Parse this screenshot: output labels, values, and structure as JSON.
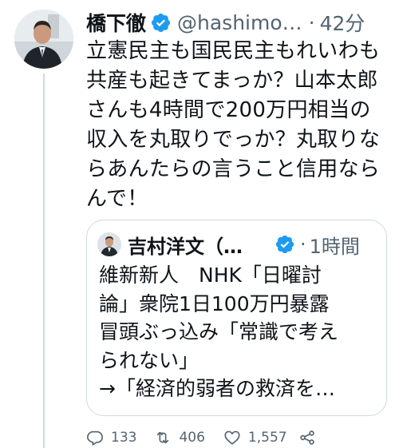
{
  "tweet": {
    "display_name": "橋下徹",
    "handle": "@hashimo…",
    "separator": "·",
    "time": "42分",
    "text_lines": [
      "立憲民主も国民民主もれいわも",
      "共産も起きてまっか？山本太郎",
      "さんも4時間で200万円相当の",
      "収入を丸取りでっか？丸取りな",
      "らあんたらの言うこと信用なら",
      "んで！"
    ]
  },
  "quote": {
    "display_name": "吉村洋文（…",
    "separator": "·",
    "time": "1時間",
    "text_lines": [
      "維新新人　NHK「日曜討",
      "論」衆院1日100万円暴露",
      "冒頭ぶっ込み「常識で考え",
      "られない」",
      "→「経済的弱者の救済を…"
    ]
  },
  "actions": {
    "reply_count": "133",
    "retweet_count": "406",
    "like_count": "1,557"
  },
  "colors": {
    "verified_blue": "#1d9bf0",
    "text": "#0f1419",
    "muted": "#536471",
    "border": "#cfd9de"
  },
  "icons": {
    "verified": "verified-badge-icon",
    "reply": "reply-icon",
    "retweet": "retweet-icon",
    "like": "heart-icon",
    "share": "share-icon"
  }
}
